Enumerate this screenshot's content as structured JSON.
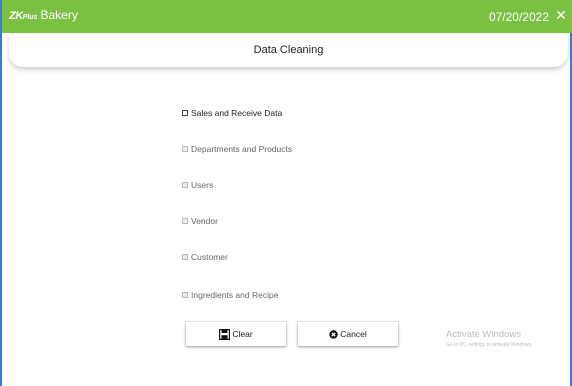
{
  "titlebar": {
    "logo_zk": "ZK",
    "logo_plus": "Plus",
    "app_name": "Bakery",
    "date": "07/20/2022",
    "close_glyph": "✕",
    "color": "#7bc043"
  },
  "header": {
    "title": "Data Cleaning"
  },
  "options": [
    {
      "label": "Sales and Receive Data",
      "checked": false,
      "enabled": true
    },
    {
      "label": "Departments and Products",
      "checked": false,
      "enabled": false
    },
    {
      "label": "Users",
      "checked": false,
      "enabled": false
    },
    {
      "label": "Vendor",
      "checked": false,
      "enabled": false
    },
    {
      "label": "Customer",
      "checked": false,
      "enabled": false
    },
    {
      "label": "Ingredients and Recipe",
      "checked": false,
      "enabled": false
    }
  ],
  "buttons": {
    "clear_label": "Clear",
    "clear_icon": "save-icon",
    "cancel_label": "Cancel",
    "cancel_icon": "cancel-circle-icon"
  },
  "watermark": {
    "title": "Activate Windows",
    "subtitle": "Go to PC settings to activate Windows."
  }
}
